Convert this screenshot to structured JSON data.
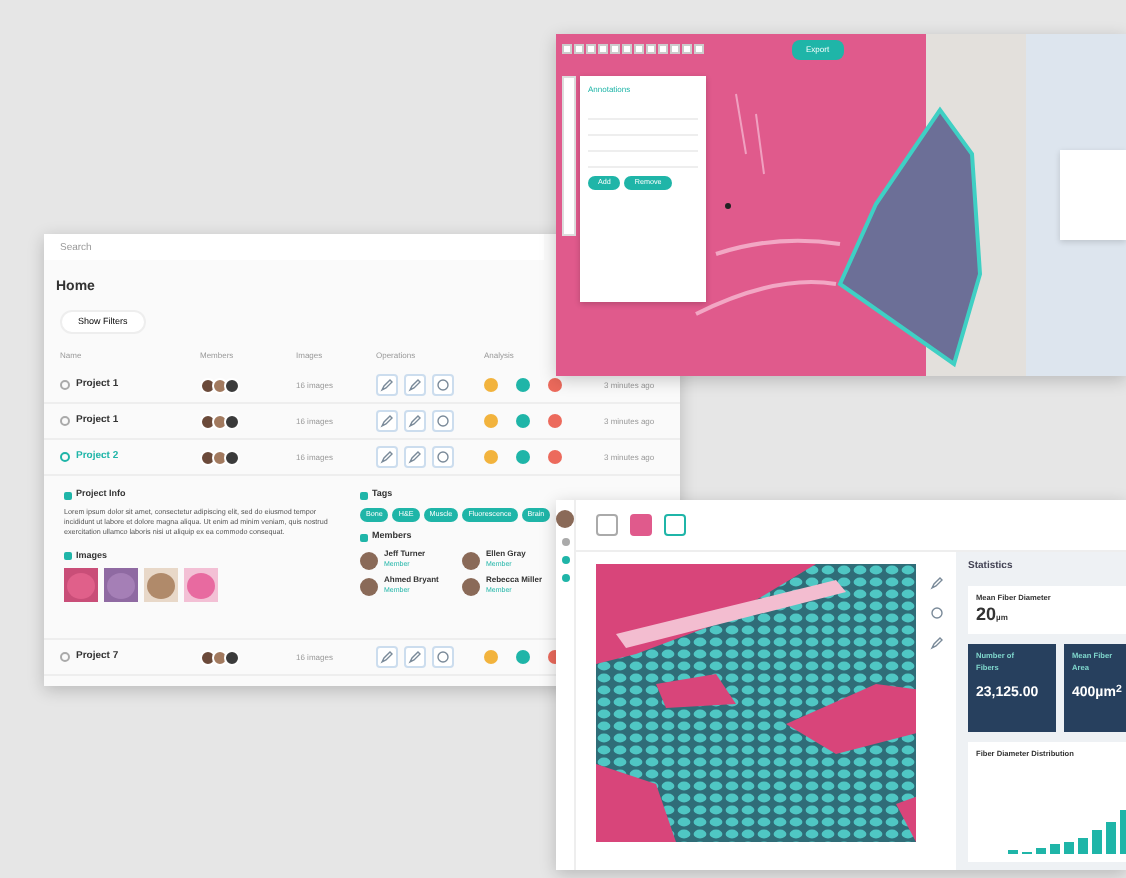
{
  "home": {
    "search": {
      "placeholder": "Search"
    },
    "title": "Home",
    "filter_button": "Show Filters",
    "columns": [
      "Name",
      "Members",
      "Images",
      "Operations",
      "Analysis"
    ],
    "rows": [
      {
        "kind": "project",
        "name": "Project 1",
        "selected": false,
        "images": "16 images",
        "updated": "3 minutes ago",
        "status": [
          {
            "color": "#f2b33d"
          },
          {
            "color": "#1fb5a8"
          },
          {
            "color": "#ec6a5c"
          }
        ]
      },
      {
        "kind": "project",
        "name": "Project 1",
        "selected": false,
        "images": "16 images",
        "updated": "3 minutes ago",
        "status": [
          {
            "color": "#f2b33d"
          },
          {
            "color": "#1fb5a8"
          },
          {
            "color": "#ec6a5c"
          }
        ]
      },
      {
        "kind": "project",
        "name": "Project 2",
        "selected": true,
        "images": "16 images",
        "updated": "3 minutes ago",
        "status": [
          {
            "color": "#f2b33d"
          },
          {
            "color": "#1fb5a8"
          },
          {
            "color": "#ec6a5c"
          }
        ]
      },
      {
        "kind": "details",
        "info_title": "Project Info",
        "description": "Lorem ipsum dolor sit amet, consectetur adipiscing elit, sed do eiusmod tempor incididunt ut labore et dolore magna aliqua. Ut enim ad minim veniam, quis nostrud exercitation ullamco laboris nisi ut aliquip ex ea commodo consequat.",
        "images_title": "Images",
        "tags_title": "Tags",
        "tags": [
          "Bone",
          "H&E",
          "Muscle",
          "Fluorescence",
          "Brain"
        ],
        "members_title": "Members",
        "members": [
          {
            "name": "Jeff Turner",
            "role": "Member"
          },
          {
            "name": "Ellen Gray",
            "role": "Member"
          },
          {
            "name": "Ahmed Bryant",
            "role": "Member"
          },
          {
            "name": "Rebecca Miller",
            "role": "Member"
          }
        ]
      },
      {
        "kind": "project",
        "name": "Project 7",
        "selected": false,
        "images": "16 images",
        "status": [
          {
            "color": "#f2b33d"
          },
          {
            "color": "#1fb5a8"
          },
          {
            "color": "#ec6a5c"
          }
        ]
      }
    ]
  },
  "viewer": {
    "action_button": "Export",
    "panel": {
      "title": "Annotations",
      "buttons": [
        "Add",
        "Remove"
      ]
    }
  },
  "analysis": {
    "statistics": {
      "title": "Statistics",
      "mean": {
        "title": "Mean Fiber Diameter",
        "value": "20",
        "unit": "µm"
      },
      "cards": [
        {
          "title": "Number of Fibers",
          "value": "23,125.00"
        },
        {
          "title": "Mean Fiber Area",
          "value": "400µm$^{2}$"
        }
      ],
      "chart_title": "Fiber Diameter Distribution"
    }
  }
}
